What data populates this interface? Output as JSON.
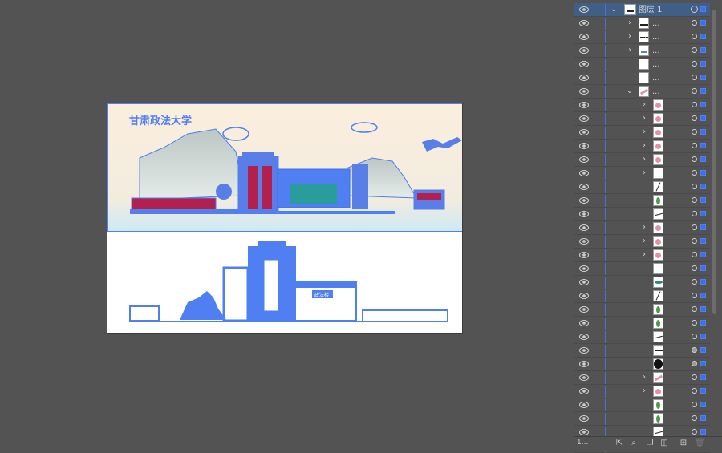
{
  "layers_panel": {
    "layer_count": "1...",
    "top_layer": {
      "name": "图层 1"
    },
    "rows": [
      {
        "depth": 1,
        "chevron": "right",
        "thumb": "skyline",
        "name": "..."
      },
      {
        "depth": 1,
        "chevron": "right",
        "thumb": "dashes",
        "name": "..."
      },
      {
        "depth": 1,
        "chevron": "right",
        "thumb": "small-art",
        "name": "..."
      },
      {
        "depth": 1,
        "chevron": "none",
        "thumb": "blank",
        "name": "..."
      },
      {
        "depth": 1,
        "chevron": "none",
        "thumb": "blank",
        "name": "..."
      },
      {
        "depth": 1,
        "chevron": "down",
        "thumb": "pink-sprig",
        "name": "..."
      },
      {
        "depth": 2,
        "chevron": "right",
        "thumb": "pink-flower",
        "name": ""
      },
      {
        "depth": 2,
        "chevron": "right",
        "thumb": "pink-flower",
        "name": ""
      },
      {
        "depth": 2,
        "chevron": "right",
        "thumb": "pink-flower",
        "name": ""
      },
      {
        "depth": 2,
        "chevron": "right",
        "thumb": "pink-flower",
        "name": ""
      },
      {
        "depth": 2,
        "chevron": "right",
        "thumb": "pink-flower",
        "name": ""
      },
      {
        "depth": 2,
        "chevron": "right",
        "thumb": "blank",
        "name": ""
      },
      {
        "depth": 2,
        "chevron": "none",
        "thumb": "stroke",
        "name": ""
      },
      {
        "depth": 2,
        "chevron": "none",
        "thumb": "leaf",
        "name": ""
      },
      {
        "depth": 2,
        "chevron": "none",
        "thumb": "curve",
        "name": ""
      },
      {
        "depth": 2,
        "chevron": "right",
        "thumb": "pink-flower",
        "name": ""
      },
      {
        "depth": 2,
        "chevron": "right",
        "thumb": "pink-flower",
        "name": ""
      },
      {
        "depth": 2,
        "chevron": "right",
        "thumb": "pink-flower",
        "name": ""
      },
      {
        "depth": 2,
        "chevron": "none",
        "thumb": "blank",
        "name": ""
      },
      {
        "depth": 2,
        "chevron": "none",
        "thumb": "leaf-h",
        "name": ""
      },
      {
        "depth": 2,
        "chevron": "none",
        "thumb": "stroke",
        "name": ""
      },
      {
        "depth": 2,
        "chevron": "none",
        "thumb": "leaf",
        "name": ""
      },
      {
        "depth": 2,
        "chevron": "none",
        "thumb": "leaf",
        "name": ""
      },
      {
        "depth": 2,
        "chevron": "none",
        "thumb": "curve",
        "name": ""
      },
      {
        "depth": 2,
        "chevron": "none",
        "thumb": "line-h",
        "name": "",
        "target": "filled"
      },
      {
        "depth": 2,
        "chevron": "none",
        "thumb": "black-circle",
        "name": "",
        "target": "filled"
      },
      {
        "depth": 2,
        "chevron": "right",
        "thumb": "pink-sprig",
        "name": ""
      },
      {
        "depth": 2,
        "chevron": "right",
        "thumb": "pink-flower",
        "name": ""
      },
      {
        "depth": 2,
        "chevron": "none",
        "thumb": "leaf",
        "name": ""
      },
      {
        "depth": 2,
        "chevron": "none",
        "thumb": "leaf",
        "name": ""
      },
      {
        "depth": 2,
        "chevron": "none",
        "thumb": "curve",
        "name": ""
      },
      {
        "depth": 2,
        "chevron": "none",
        "thumb": "stroke",
        "name": ""
      }
    ]
  },
  "artboard": {
    "title_text": "甘肃政法大学",
    "sign_text": "政法楼",
    "selection_color": "#4f7ff0",
    "sky_top": "#fbeedd",
    "sky_bottom": "#d4ecf6",
    "accent": "#b2204d"
  }
}
